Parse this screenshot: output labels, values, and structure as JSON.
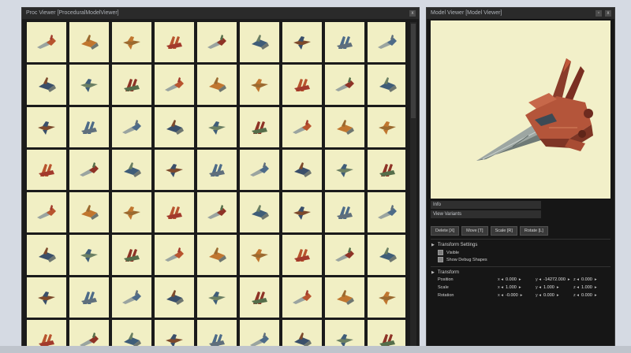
{
  "proc_viewer": {
    "title": "Proc Viewer  [ProceduralModelViewer]",
    "btn_close": "x"
  },
  "model_viewer": {
    "title": "Model Viewer  [Model Viewer]",
    "btn_pin": "▫",
    "btn_close": "x",
    "info_label": "Info",
    "variants_label": "View Variants",
    "tools": {
      "delete": "Delete [X]",
      "move": "Move [T]",
      "scale": "Scale [R]",
      "rotate": "Rotate [L]"
    },
    "transform_settings": {
      "heading": "Transform Settings",
      "visible": "Visible",
      "debug": "Show Debug Shapes"
    },
    "transform": {
      "heading": "Transform",
      "rows": [
        {
          "label": "Position",
          "x": "0.000",
          "y": "-14272.000",
          "z": "0.000"
        },
        {
          "label": "Scale",
          "x": "1.000",
          "y": "1.000",
          "z": "1.000"
        },
        {
          "label": "Rotation",
          "x": "-0.000",
          "y": "0.000",
          "z": "0.000"
        }
      ]
    }
  },
  "colors": {
    "thumb_bg": "#f1efc4",
    "panel_bg": "#161616",
    "ship_palette": [
      "#b8542e",
      "#3f5d78",
      "#6b7f63",
      "#a23a2c",
      "#4d6b88",
      "#c0762f",
      "#7d4a2c",
      "#556e4a",
      "#8e3326",
      "#3a4f6a",
      "#9b6a2f",
      "#5f6f7c"
    ]
  }
}
